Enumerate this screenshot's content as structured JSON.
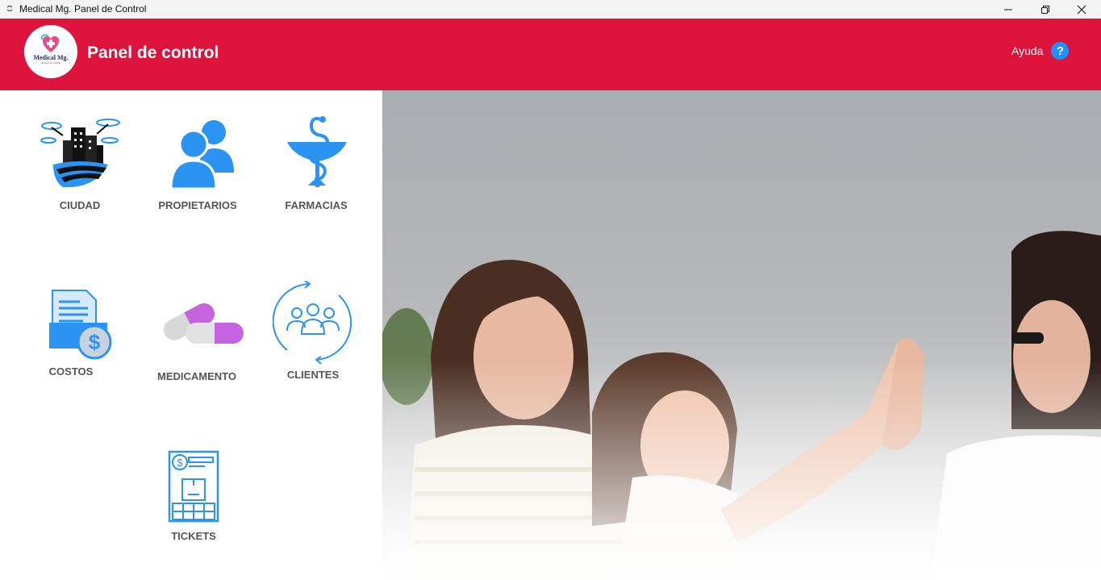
{
  "window": {
    "title": "Medical Mg. Panel de Control",
    "controls": {
      "minimize": "minimize-icon",
      "maximize": "restore-icon",
      "close": "close-icon"
    }
  },
  "header": {
    "logo_text": "Medical Mg.",
    "logo_subtext": "HEALTH CARE",
    "title": "Panel de control",
    "help_label": "Ayuda",
    "help_icon_glyph": "?",
    "background_color": "#dc143c"
  },
  "menu": {
    "items": [
      {
        "label": "CIUDAD",
        "icon": "city-drones-icon"
      },
      {
        "label": "PROPIETARIOS",
        "icon": "users-icon"
      },
      {
        "label": "FARMACIAS",
        "icon": "pharmacy-snake-bowl-icon"
      },
      {
        "label": "COSTOS",
        "icon": "cost-documents-icon"
      },
      {
        "label": "MEDICAMENTO",
        "icon": "pills-icon"
      },
      {
        "label": "CLIENTES",
        "icon": "clients-cycle-icon"
      },
      {
        "label": "TICKETS",
        "icon": "ticket-receipt-icon"
      }
    ],
    "accent_color": "#2b93f2"
  }
}
